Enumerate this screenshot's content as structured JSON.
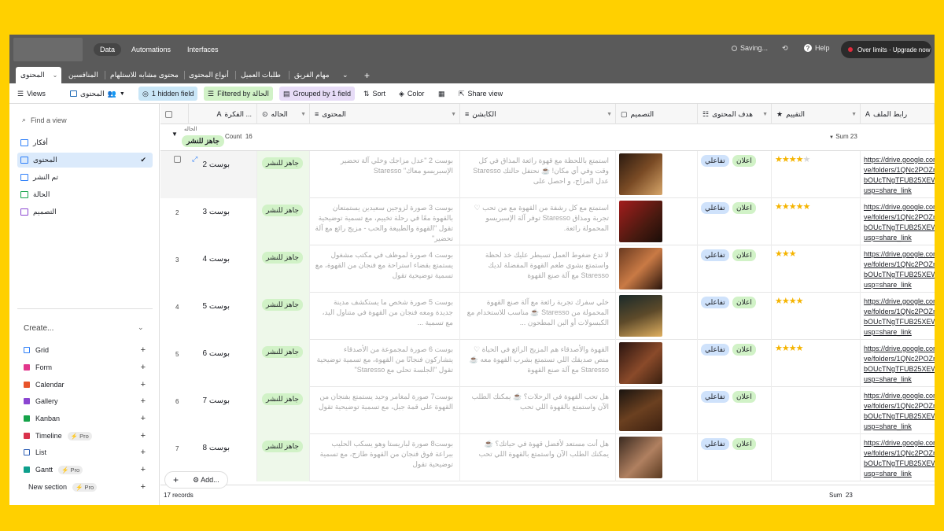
{
  "topbar": {
    "nav": [
      "Data",
      "Automations",
      "Interfaces"
    ],
    "saving": "Saving...",
    "help": "Help",
    "upgrade": "Over limits · Upgrade now"
  },
  "tabs": [
    "المحتوى",
    "المنافسين",
    "محتوى مشابه للاستلهام",
    "أنواع المحتوى",
    "طلبات العميل",
    "مهام الفريق"
  ],
  "viewbar": {
    "views": "Views",
    "view_name": "المحتوى",
    "hidden": "1 hidden field",
    "filter": "Filtered by الحالة",
    "group": "Grouped by 1 field",
    "sort": "Sort",
    "color": "Color",
    "share": "Share view"
  },
  "sidebar": {
    "find": "Find a view",
    "views": [
      "أفكار",
      "المحتوى",
      "تم النشر",
      "الحالة",
      "التصميم"
    ],
    "create": "Create...",
    "create_items": [
      "Grid",
      "Form",
      "Calendar",
      "Gallery",
      "Kanban",
      "Timeline",
      "List",
      "Gantt",
      "New section"
    ],
    "pro": "Pro"
  },
  "columns": [
    "الفكرة ...",
    "الحاله",
    "المحتوى",
    "الكابشن",
    "التصميم",
    "هدف المحتوى",
    "التقييم",
    "رابط الملف"
  ],
  "group": {
    "label": "الحاله",
    "value": "جاهز للنشر",
    "count_label": "Count",
    "count": "16",
    "sum_label": "Sum",
    "sum": "23"
  },
  "rows": [
    {
      "num": "",
      "title": "بوست 2",
      "status": "جاهز للنشر",
      "content": "بوست 2 \"عدل مزاجك وخلي آلة تحضير الإسبريسو معاك\" Staresso",
      "caption": "استمتع باللحظة مع قهوة رائعة المذاق في كل وقت وفي أي مكان! ☕ نحتفل حالتك Staresso عدل المزاج، و احصل على",
      "tags": [
        "اعلان",
        "تفاعلي"
      ],
      "rating": 4,
      "link": [
        "https://drive.google.com/dri",
        "ve/folders/1QNc2POZmXo",
        "bOUcTNgTFUB25XEWmc?",
        "usp=share_link"
      ]
    },
    {
      "num": "2",
      "title": "بوست 3",
      "status": "جاهز للنشر",
      "content": "بوست 3 صورة لزوجين سعيدين يستمتعان بالقهوة معًا في رحلة تخييم، مع تسمية توضيحية تقول \"القهوة والطبيعة والحب - مزيج رائع مع آلة تحضير\"",
      "caption": "استمتع مع كل رشفة من القهوة مع من تحب ♡ تجربة ومذاق Staresso توفر آلة الإسبريسو المحمولة رائعة.",
      "tags": [
        "اعلان",
        "تفاعلي"
      ],
      "rating": 5,
      "link": [
        "https://drive.google.com/dri",
        "ve/folders/1QNc2POZmXo",
        "bOUcTNgTFUB25XEWmc?",
        "usp=share_link"
      ]
    },
    {
      "num": "3",
      "title": "بوست 4",
      "status": "جاهز للنشر",
      "content": "بوست 4 صورة لموظف في مكتب مشغول يستمتع بقضاء استراحة مع فنجان من القهوة، مع تسمية توضيحية تقول",
      "caption": "لا تدع ضغوط العمل تسيطر عليك خذ لحظة واستمتع بشوي طعم القهوة المفضلة لديك Staresso مع آلة صنع القهوة",
      "tags": [
        "اعلان",
        "تفاعلي"
      ],
      "rating": 3,
      "link": [
        "https://drive.google.com/dri",
        "ve/folders/1QNc2POZmXo",
        "bOUcTNgTFUB25XEWmc?",
        "usp=share_link"
      ]
    },
    {
      "num": "4",
      "title": "بوست 5",
      "status": "جاهز للنشر",
      "content": "بوست 5 صورة شخص ما يستكشف مدينة جديدة ومعه فنجان من القهوة في متناول اليد، مع تسمية ...",
      "caption": "خلي سفرك تجربة رائعة مع آلة صنع القهوة المحمولة من Staresso ☕ مناسب للاستخدام مع الكبسولات أو البن المطحون ...",
      "tags": [
        "اعلان",
        "تفاعلي"
      ],
      "rating": 4,
      "link": [
        "https://drive.google.com/dri",
        "ve/folders/1QNc2POZmXo",
        "bOUcTNgTFUB25XEWmc?",
        "usp=share_link"
      ]
    },
    {
      "num": "5",
      "title": "بوست 6",
      "status": "جاهز للنشر",
      "content": "بوست 6 صورة لمجموعة من الأصدقاء يتشاركون فنجانًا من القهوة، مع تسمية توضيحية تقول \"الجلسة تحلى مع Staresso\"",
      "caption": "القهوة والأصدقاء هم المزيج الرائع في الحياة ♡ منص صديقك اللي تستمتع بشرب القهوة معه ☕ Staresso مع آلة صنع القهوة",
      "tags": [
        "اعلان",
        "تفاعلي"
      ],
      "rating": 4,
      "link": [
        "https://drive.google.com/dri",
        "ve/folders/1QNc2POZmXo",
        "bOUcTNgTFUB25XEWmc?",
        "usp=share_link"
      ]
    },
    {
      "num": "6",
      "title": "بوست 7",
      "status": "جاهز للنشر",
      "content": "بوست7 صورة لمغامر وحيد يستمتع بفنجان من القهوة على قمة جبل، مع تسمية توضيحية تقول",
      "caption": "هل تحب القهوة في الرحلات؟ ☕ يمكنك الطلب الآن واستمتع بالقهوة اللي تحب",
      "tags": [
        "اعلان",
        "تفاعلي"
      ],
      "rating": 0,
      "link": [
        "https://drive.google.com/dri",
        "ve/folders/1QNc2POZmXo",
        "bOUcTNgTFUB25XEWmc?",
        "usp=share_link"
      ]
    },
    {
      "num": "7",
      "title": "بوست 8",
      "status": "جاهز للنشر",
      "content": "بوست8 صورة لباريستا وهو يسكب الحليب ببراعة فوق فنجان من القهوة طازج، مع تسمية توضيحية تقول",
      "caption": "هل أنت مستعد لأفضل قهوة في حياتك؟ ☕ يمكنك الطلب الآن واستمتع بالقهوة اللي تحب",
      "tags": [
        "اعلان",
        "تفاعلي"
      ],
      "rating": 0,
      "link": [
        "https://drive.google.com/dri",
        "ve/folders/1QNc2POZmXo",
        "bOUcTNgTFUB25XEWmc?",
        "usp=share_link"
      ]
    }
  ],
  "footer": {
    "records": "17 records",
    "add": "Add...",
    "sum_label": "Sum",
    "sum": "23"
  }
}
